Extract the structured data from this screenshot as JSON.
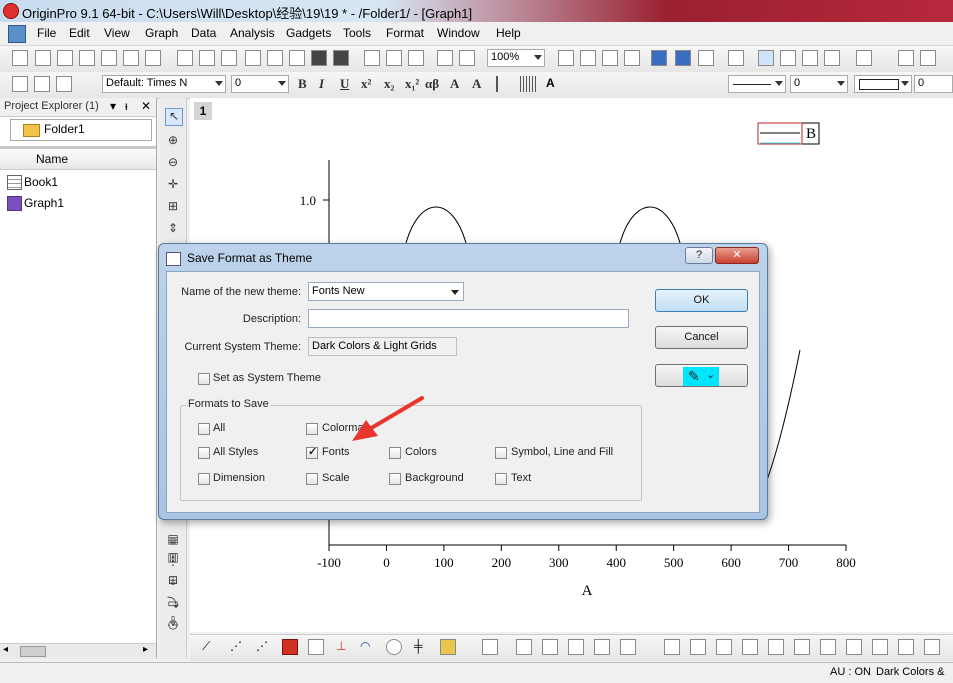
{
  "window": {
    "title": "OriginPro 9.1 64-bit - C:\\Users\\Will\\Desktop\\经验\\19\\19 * - /Folder1/ - [Graph1]"
  },
  "menu": [
    "File",
    "Edit",
    "View",
    "Graph",
    "Data",
    "Analysis",
    "Gadgets",
    "Tools",
    "Format",
    "Window",
    "Help"
  ],
  "toolbar": {
    "zoom": "100%",
    "font": "Default: Times N",
    "font_size": "0",
    "line_width": "0",
    "fill_value": "0"
  },
  "format_buttons": [
    "B",
    "I",
    "U",
    "x²",
    "x₂",
    "x₁²",
    "αβ",
    "A",
    "A"
  ],
  "project_explorer": {
    "title": "Project Explorer (1)",
    "folder": "Folder1",
    "column_header": "Name",
    "items": [
      {
        "label": "Book1",
        "icon": "workbook-icon"
      },
      {
        "label": "Graph1",
        "icon": "graph-icon"
      }
    ]
  },
  "graph": {
    "page_number": "1",
    "legend_label": "B",
    "x_label": "A",
    "y_tick": "1.0",
    "x_ticks": [
      "-100",
      "0",
      "100",
      "200",
      "300",
      "400",
      "500",
      "600",
      "700",
      "800"
    ]
  },
  "chart_data": {
    "type": "line",
    "xlabel": "A",
    "xlim": [
      -100,
      800
    ],
    "x": [
      -100,
      0,
      100,
      200,
      300,
      400,
      500,
      600,
      700,
      800
    ],
    "series": [
      {
        "name": "B",
        "description": "sinusoid peaking at 1.0 near x=90 and x=450"
      }
    ]
  },
  "dialog": {
    "title": "Save Format as Theme",
    "help_label": "?",
    "close_label": "✕",
    "name_label": "Name of the new theme:",
    "name_value": "Fonts New",
    "description_label": "Description:",
    "description_value": "",
    "current_label": "Current System Theme:",
    "current_value": "Dark Colors & Light Grids",
    "set_system_label": "Set as System Theme",
    "group_label": "Formats to Save",
    "checkboxes": [
      {
        "label": "All",
        "checked": false
      },
      {
        "label": "Colormap",
        "checked": false
      },
      {
        "label": "All Styles",
        "checked": false
      },
      {
        "label": "Fonts",
        "checked": true
      },
      {
        "label": "Colors",
        "checked": false
      },
      {
        "label": "Symbol, Line and Fill",
        "checked": false
      },
      {
        "label": "Dimension",
        "checked": false
      },
      {
        "label": "Scale",
        "checked": false
      },
      {
        "label": "Background",
        "checked": false
      },
      {
        "label": "Text",
        "checked": false
      }
    ],
    "ok_label": "OK",
    "cancel_label": "Cancel"
  },
  "status": {
    "au": "AU : ON",
    "theme": "Dark Colors &"
  },
  "colors": {
    "dialog_frame": "#a9c4e2",
    "arrow": "#e8352e",
    "pencil_button": "#00e5ff"
  }
}
